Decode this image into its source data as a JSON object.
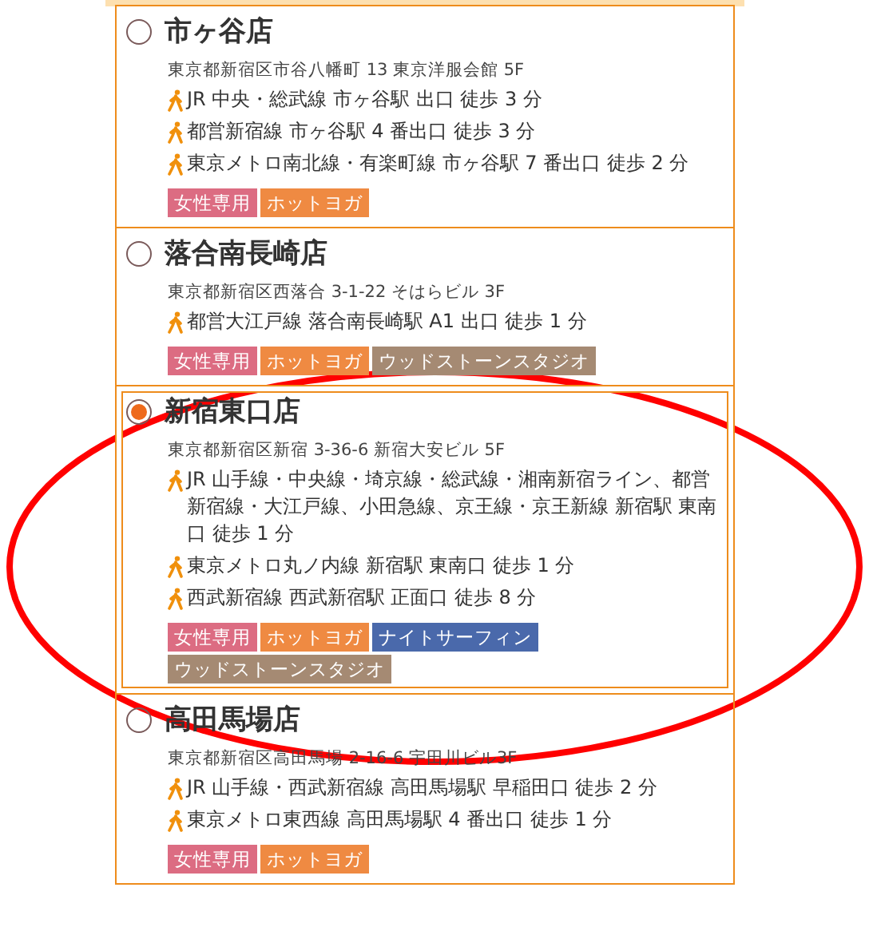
{
  "stores": [
    {
      "name": "市ヶ谷店",
      "selected": false,
      "address": "東京都新宿区市谷八幡町 13 東京洋服会館 5F",
      "routes": [
        "JR 中央・総武線 市ヶ谷駅 出口 徒歩 3 分",
        "都営新宿線 市ヶ谷駅 4 番出口 徒歩 3 分",
        "東京メトロ南北線・有楽町線 市ヶ谷駅 7 番出口 徒歩 2 分"
      ],
      "tags": [
        {
          "label": "女性専用",
          "color": "#dc6c82"
        },
        {
          "label": "ホットヨガ",
          "color": "#ef8a42"
        }
      ]
    },
    {
      "name": "落合南長崎店",
      "selected": false,
      "address": "東京都新宿区西落合 3-1-22 そはらビル 3F",
      "routes": [
        "都営大江戸線 落合南長崎駅 A1 出口 徒歩 1 分"
      ],
      "tags": [
        {
          "label": "女性専用",
          "color": "#dc6c82"
        },
        {
          "label": "ホットヨガ",
          "color": "#ef8a42"
        },
        {
          "label": "ウッドストーンスタジオ",
          "color": "#a58a73"
        }
      ]
    },
    {
      "name": "新宿東口店",
      "selected": true,
      "address": "東京都新宿区新宿 3-36-6 新宿大安ビル 5F",
      "routes": [
        "JR 山手線・中央線・埼京線・総武線・湘南新宿ライン、都営新宿線・大江戸線、小田急線、京王線・京王新線 新宿駅 東南口 徒歩 1 分",
        "東京メトロ丸ノ内線 新宿駅 東南口 徒歩 1 分",
        "西武新宿線 西武新宿駅 正面口 徒歩 8 分"
      ],
      "tags": [
        {
          "label": "女性専用",
          "color": "#dc6c82"
        },
        {
          "label": "ホットヨガ",
          "color": "#ef8a42"
        },
        {
          "label": "ナイトサーフィン",
          "color": "#4a69ab"
        },
        {
          "label": "ウッドストーンスタジオ",
          "color": "#a58a73"
        }
      ]
    },
    {
      "name": "高田馬場店",
      "selected": false,
      "address": "東京都新宿区高田馬場 2-16-6 宇田川ビル3F",
      "routes": [
        "JR 山手線・西武新宿線 高田馬場駅 早稲田口 徒歩 2 分",
        "東京メトロ東西線 高田馬場駅 4 番出口 徒歩 1 分"
      ],
      "tags": [
        {
          "label": "女性専用",
          "color": "#dc6c82"
        },
        {
          "label": "ホットヨガ",
          "color": "#ef8a42"
        }
      ]
    }
  ]
}
